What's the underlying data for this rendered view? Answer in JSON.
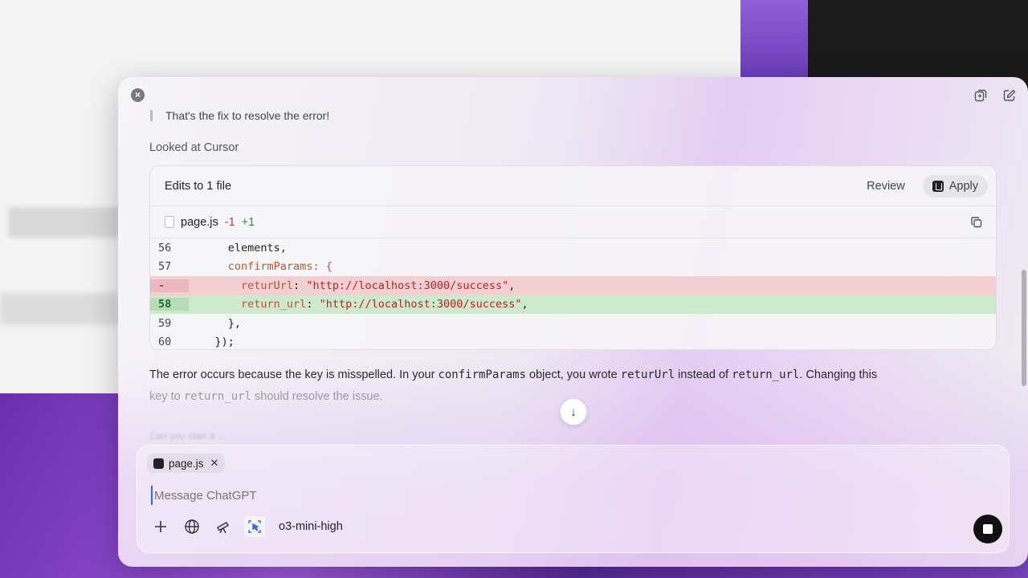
{
  "previous_message": "That's the fix to resolve the error!",
  "looked_at": "Looked at Cursor",
  "edits": {
    "title": "Edits to 1 file",
    "review_label": "Review",
    "apply_label": "Apply",
    "file_name": "page.js",
    "removed_count": "-1",
    "added_count": "+1",
    "lines": [
      {
        "num": "56",
        "type": "context",
        "indent": "      ",
        "text": "elements,"
      },
      {
        "num": "57",
        "type": "context",
        "indent": "      ",
        "text": "confirmParams: {"
      },
      {
        "num": "-",
        "type": "removed",
        "indent": "        ",
        "key": "returUrl",
        "value": "\"http://localhost:3000/success\""
      },
      {
        "num": "58",
        "type": "added",
        "indent": "        ",
        "key": "return_url",
        "value": "\"http://localhost:3000/success\""
      },
      {
        "num": "59",
        "type": "context",
        "indent": "      ",
        "text": "},"
      },
      {
        "num": "60",
        "type": "context",
        "indent": "    ",
        "text": "});"
      }
    ]
  },
  "explanation": {
    "p1": "The error occurs because the key is misspelled. In your ",
    "code1": "confirmParams",
    "p2": " object, you wrote ",
    "code2": "returUrl",
    "p3": " instead of ",
    "code3": "return_url",
    "p4": ". Changing this",
    "p5": "key to ",
    "code4": "return_url",
    "p6": " should resolve the issue."
  },
  "ghost_followup": "Can you start a ... ",
  "composer": {
    "attachment": "page.js",
    "placeholder": "Message ChatGPT",
    "model": "o3-mini-high"
  },
  "icons": {
    "close": "close-icon",
    "new_window": "new-window-icon",
    "edit": "compose-icon",
    "copy": "copy-icon",
    "scroll_down": "arrow-down-icon",
    "plus": "plus-icon",
    "globe": "globe-icon",
    "telescope": "telescope-icon",
    "cursor_select": "cursor-select-icon",
    "stop": "stop-icon"
  },
  "colors": {
    "removed_bg": "#f1cfd3",
    "added_bg": "#cfe9cf",
    "accent": "#2b6de8"
  }
}
